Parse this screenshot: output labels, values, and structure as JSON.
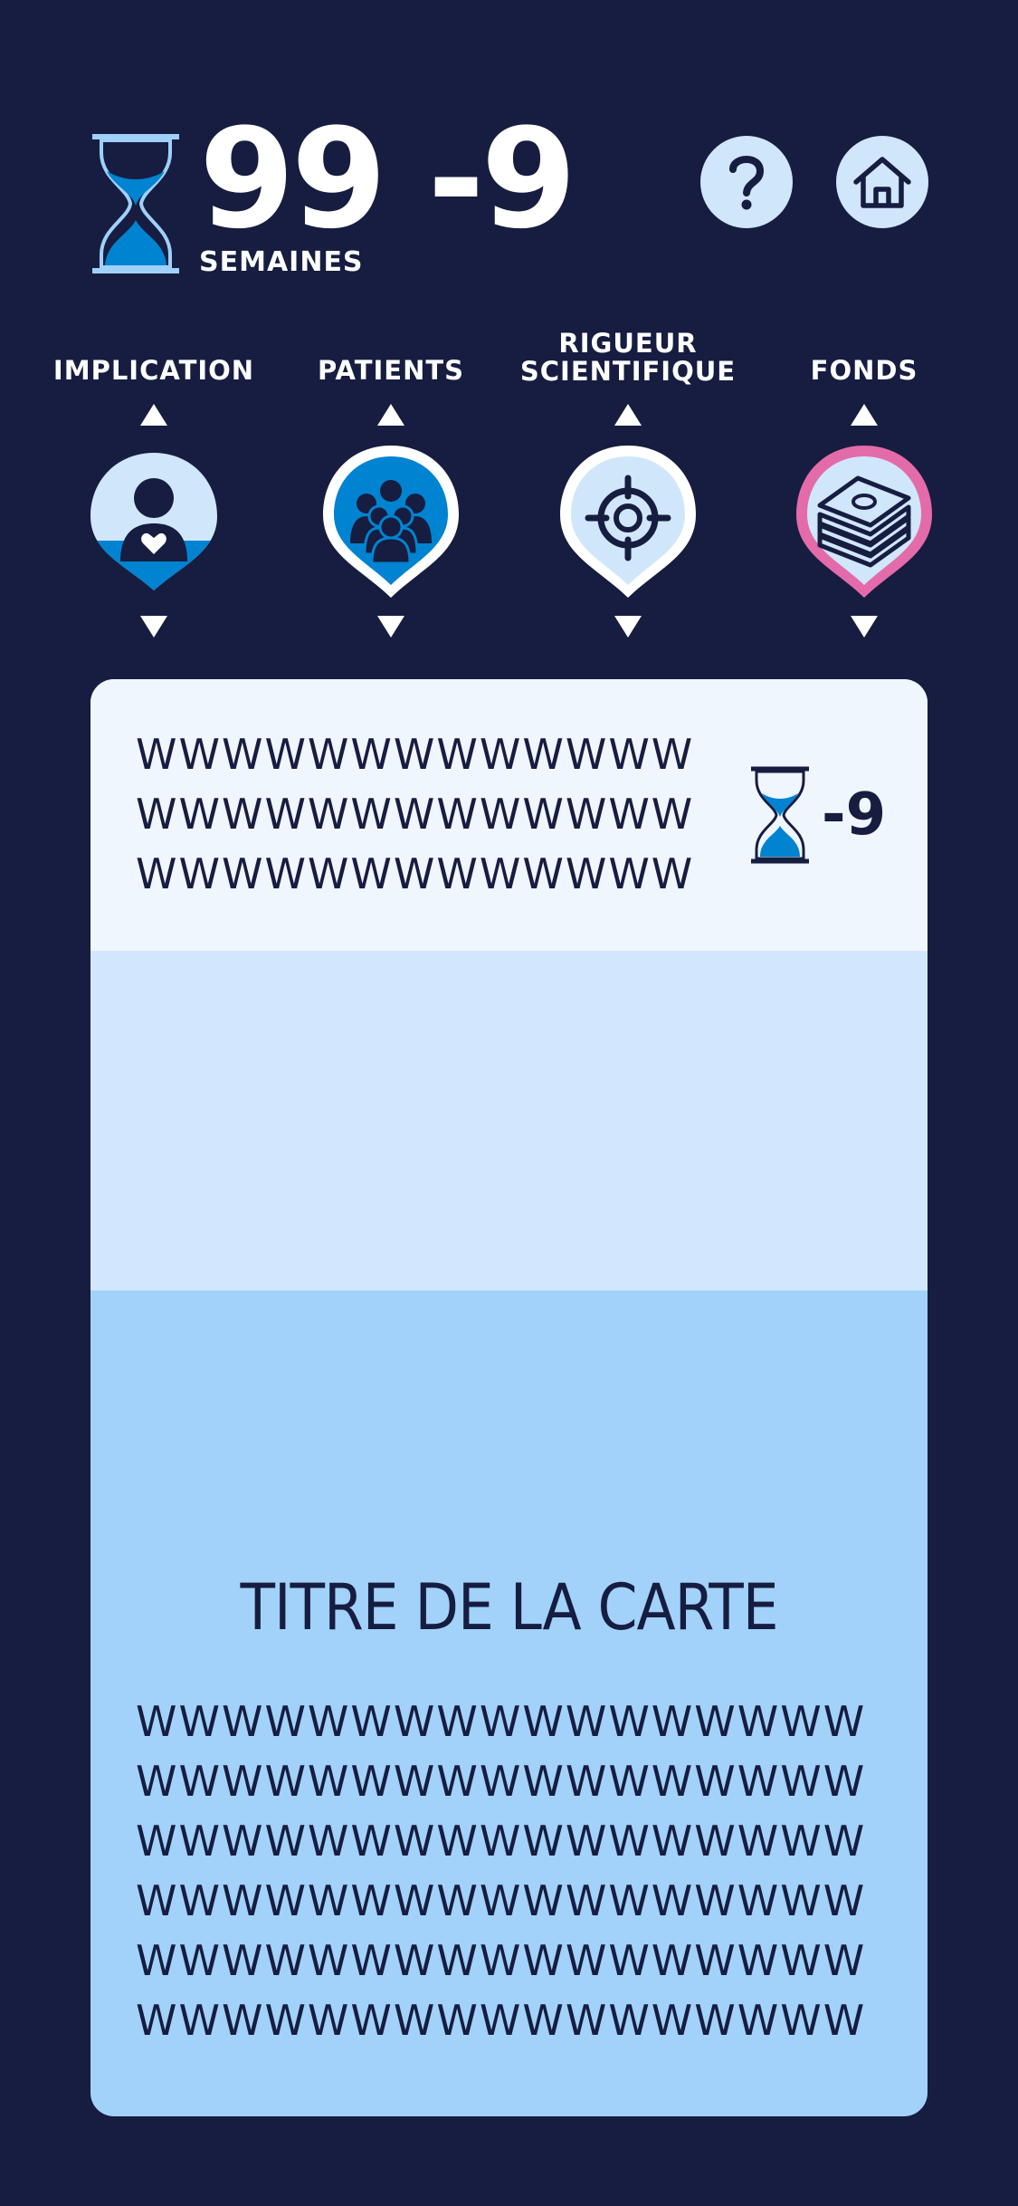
{
  "header": {
    "weeks_value": "99 -9",
    "weeks_label": "SEMAINES",
    "help_icon": "question-icon",
    "home_icon": "home-icon"
  },
  "stats": [
    {
      "label": "IMPLICATION",
      "icon": "person-heart-icon",
      "level": 0.35,
      "color": "#0083d1"
    },
    {
      "label": "PATIENTS",
      "icon": "group-icon",
      "level": 1.0,
      "color": "#0083d1"
    },
    {
      "label": "RIGUEUR\nSCIENTIFIQUE",
      "icon": "target-icon",
      "level": 0.0,
      "color": "#0083d1"
    },
    {
      "label": "FONDS",
      "icon": "money-icon",
      "level": 0.0,
      "color": "#e46ba9"
    }
  ],
  "card": {
    "description": "WWWWWWWWWWWWW\nWWWWWWWWWWWWW\nWWWWWWWWWWWWW",
    "cost": "-9",
    "title": "TITRE DE LA CARTE",
    "body": "WWWWWWWWWWWWWWWWW\nWWWWWWWWWWWWWWWWW\nWWWWWWWWWWWWWWWWW\nWWWWWWWWWWWWWWWWW\nWWWWWWWWWWWWWWWWW\nWWWWWWWWWWWWWWWWW"
  },
  "colors": {
    "background": "#161d40",
    "accent_blue": "#0083d1",
    "light_blue": "#d0e6fb",
    "pink": "#e46ba9"
  }
}
